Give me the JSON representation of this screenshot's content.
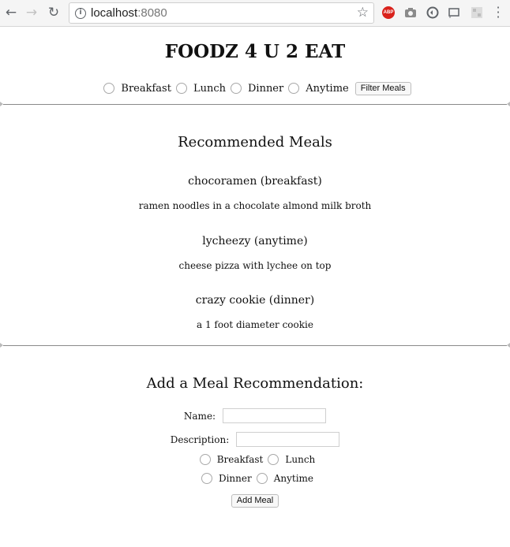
{
  "browser": {
    "url_host": "localhost",
    "url_port": ":8080",
    "abp_label": "ABP"
  },
  "page": {
    "title": "FOODZ 4 U 2 EAT",
    "filter": {
      "options": [
        "Breakfast",
        "Lunch",
        "Dinner",
        "Anytime"
      ],
      "button_label": "Filter Meals"
    },
    "recommended": {
      "heading": "Recommended Meals",
      "meals": [
        {
          "name": "chocoramen (breakfast)",
          "description": "ramen noodles in a chocolate almond milk broth"
        },
        {
          "name": "lycheezy (anytime)",
          "description": "cheese pizza with lychee on top"
        },
        {
          "name": "crazy cookie (dinner)",
          "description": "a 1 foot diameter cookie"
        }
      ]
    },
    "add_form": {
      "heading": "Add a Meal Recommendation:",
      "name_label": "Name:",
      "name_value": "",
      "description_label": "Description:",
      "description_value": "",
      "options": [
        "Breakfast",
        "Lunch",
        "Dinner",
        "Anytime"
      ],
      "button_label": "Add Meal"
    }
  }
}
